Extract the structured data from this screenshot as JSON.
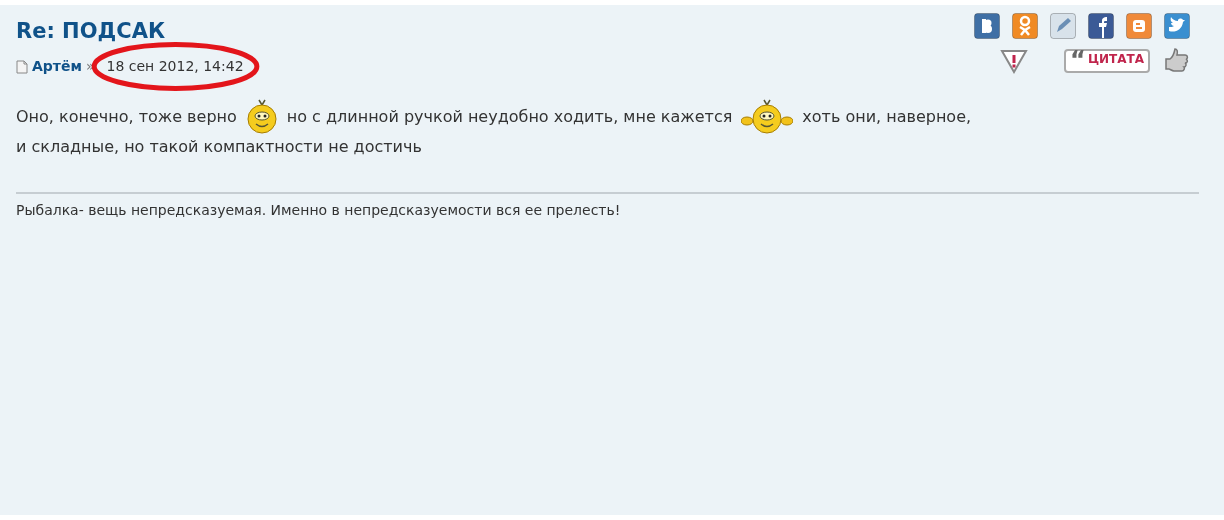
{
  "post": {
    "title": "Re: ПОДСАК",
    "author": "Артём",
    "separator": "»",
    "date": "18 сен 2012, 14:42",
    "share_icons": [
      {
        "kind": "vk"
      },
      {
        "kind": "ok"
      },
      {
        "kind": "lj"
      },
      {
        "kind": "fb"
      },
      {
        "kind": "blogger"
      },
      {
        "kind": "twitter"
      }
    ],
    "quote_button": {
      "mark": "“",
      "label": "ЦИТАТА"
    },
    "message": [
      {
        "kind": "text",
        "text": "Оно, конечно, тоже верно"
      },
      {
        "kind": "smiley"
      },
      {
        "kind": "text",
        "text": "но с длинной ручкой неудобно ходить, мне кажется"
      },
      {
        "kind": "smiley_waving"
      },
      {
        "kind": "text",
        "text": "хоть они, наверное,"
      },
      {
        "kind": "text",
        "text": "и складные, но такой компактности не достичь"
      }
    ],
    "signature": "Рыбалка- вещь непредсказуемая. Именно в непредсказуемости вся ее прелесть!"
  }
}
